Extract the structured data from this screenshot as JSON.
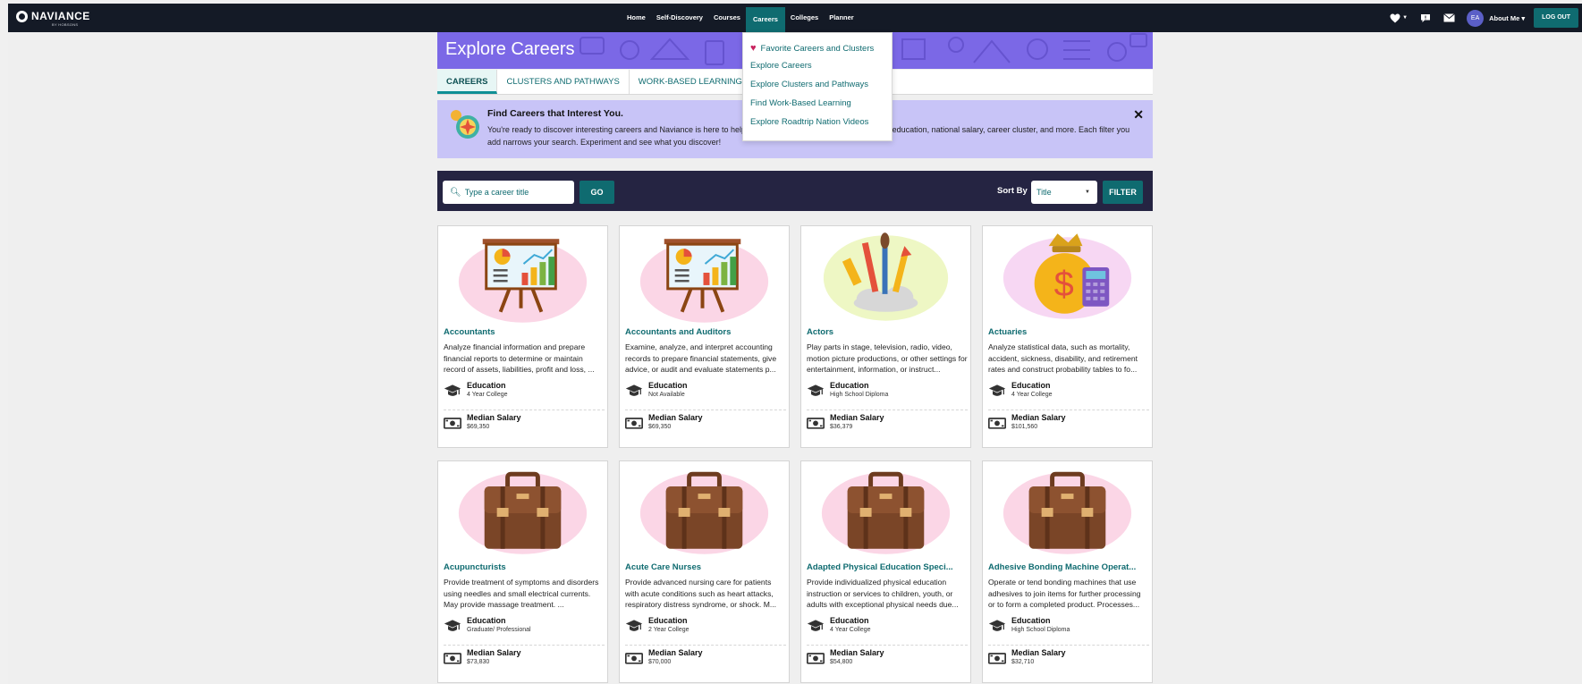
{
  "brand": {
    "name": "NAVIANCE",
    "sub": "BY HOBSONS"
  },
  "nav": {
    "items": [
      {
        "label": "Home"
      },
      {
        "label": "Self-Discovery"
      },
      {
        "label": "Courses"
      },
      {
        "label": "Careers",
        "active": true
      },
      {
        "label": "Colleges"
      },
      {
        "label": "Planner"
      }
    ],
    "avatar_initials": "EA",
    "about_me": "About Me ▾",
    "logout": "LOG OUT"
  },
  "careers_menu": {
    "items": [
      {
        "label": "Favorite Careers and Clusters",
        "icon": "heart-icon"
      },
      {
        "label": "Explore Careers"
      },
      {
        "label": "Explore Clusters and Pathways"
      },
      {
        "label": "Find Work-Based Learning"
      },
      {
        "label": "Explore Roadtrip Nation Videos"
      }
    ]
  },
  "page": {
    "title": "Explore Careers",
    "tabs": [
      {
        "label": "CAREERS",
        "active": true
      },
      {
        "label": "CLUSTERS AND PATHWAYS"
      },
      {
        "label": "WORK-BASED LEARNING"
      }
    ]
  },
  "banner": {
    "title": "Find Careers that Interest You.",
    "text": "You're ready to discover interesting careers and Naviance is here to help. Use the filters to narrow your results by education, national salary, career cluster, and more. Each filter you add narrows your search. Experiment and see what you discover!",
    "close": "✕"
  },
  "search": {
    "placeholder": "Type a career title",
    "go_label": "GO",
    "sort_label": "Sort By",
    "sort_value": "Title",
    "filter_label": "FILTER"
  },
  "labels": {
    "education": "Education",
    "salary": "Median Salary"
  },
  "careers": [
    {
      "title": "Accountants",
      "image": "presentation-board",
      "description": "Analyze financial information and prepare financial reports to determine or maintain record of assets, liabilities, profit and loss, ...",
      "education": "4 Year College",
      "salary": "$69,350"
    },
    {
      "title": "Accountants and Auditors",
      "image": "presentation-board",
      "description": "Examine, analyze, and interpret accounting records to prepare financial statements, give advice, or audit and evaluate statements p...",
      "education": "Not Available",
      "salary": "$69,350"
    },
    {
      "title": "Actors",
      "image": "art-brushes",
      "description": "Play parts in stage, television, radio, video, motion picture productions, or other settings for entertainment, information, or instruct...",
      "education": "High School Diploma",
      "salary": "$36,379"
    },
    {
      "title": "Actuaries",
      "image": "money-bag",
      "description": "Analyze statistical data, such as mortality, accident, sickness, disability, and retirement rates and construct probability tables to fo...",
      "education": "4 Year College",
      "salary": "$101,560"
    },
    {
      "title": "Acupuncturists",
      "image": "briefcase",
      "description": "Provide treatment of symptoms and disorders using needles and small electrical currents. May provide massage treatment. ...",
      "education": "Graduate/ Professional",
      "salary": "$73,830"
    },
    {
      "title": "Acute Care Nurses",
      "image": "briefcase",
      "description": "Provide advanced nursing care for patients with acute conditions such as heart attacks, respiratory distress syndrome, or shock. M...",
      "education": "2 Year College",
      "salary": "$70,000"
    },
    {
      "title": "Adapted Physical Education Speci...",
      "image": "briefcase",
      "description": "Provide individualized physical education instruction or services to children, youth, or adults with exceptional physical needs due...",
      "education": "4 Year College",
      "salary": "$54,800"
    },
    {
      "title": "Adhesive Bonding Machine Operat...",
      "image": "briefcase",
      "description": "Operate or tend bonding machines that use adhesives to join items for further processing or to form a completed product. Processes...",
      "education": "High School Diploma",
      "salary": "$32,710"
    }
  ],
  "colors": {
    "topbar": "#141a26",
    "accent": "#0f6b70",
    "hero": "#7b68e6",
    "banner": "#c8c4f7",
    "searchbar": "#252442",
    "heart": "#c8235e"
  }
}
